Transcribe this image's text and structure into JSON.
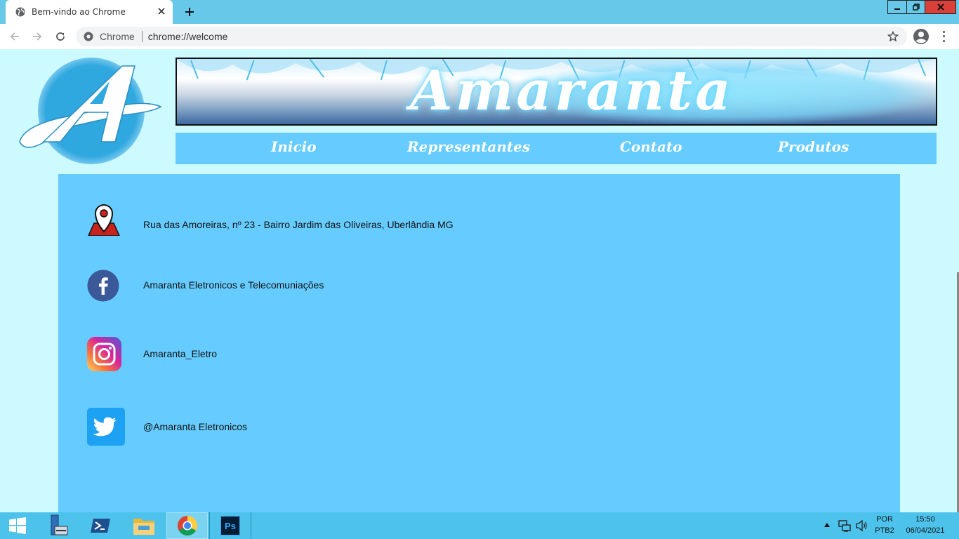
{
  "browser": {
    "tab_title": "Bem-vindo ao Chrome",
    "omnibox_origin": "Chrome",
    "omnibox_url": "chrome://welcome"
  },
  "page": {
    "brand": "Amaranta",
    "nav": [
      {
        "label": "Inicio"
      },
      {
        "label": "Representantes"
      },
      {
        "label": "Contato"
      },
      {
        "label": "Produtos"
      }
    ],
    "contacts": [
      {
        "icon": "map-pin-icon",
        "text": "Rua das Amoreiras, nº 23 - Bairro Jardim das Oliveiras, Uberlândia MG"
      },
      {
        "icon": "facebook-icon",
        "text": "Amaranta Eletronicos e Telecomuniações"
      },
      {
        "icon": "instagram-icon",
        "text": "Amaranta_Eletro"
      },
      {
        "icon": "twitter-icon",
        "text": "@Amaranta Eletronicos"
      }
    ],
    "colors": {
      "background": "#ccfaff",
      "nav_bar": "#66ccff",
      "content_panel": "#66ccff",
      "logo_blue": "#2fa7df",
      "facebook": "#3b5998",
      "twitter": "#1da1f2"
    }
  },
  "taskbar": {
    "apps": [
      "windows-start-icon",
      "server-manager-icon",
      "powershell-icon",
      "file-explorer-icon",
      "chrome-icon",
      "photoshop-icon"
    ],
    "photoshop_label": "Ps",
    "language_top": "POR",
    "language_bottom": "PTB2",
    "time": "15:50",
    "date": "06/04/2021"
  }
}
